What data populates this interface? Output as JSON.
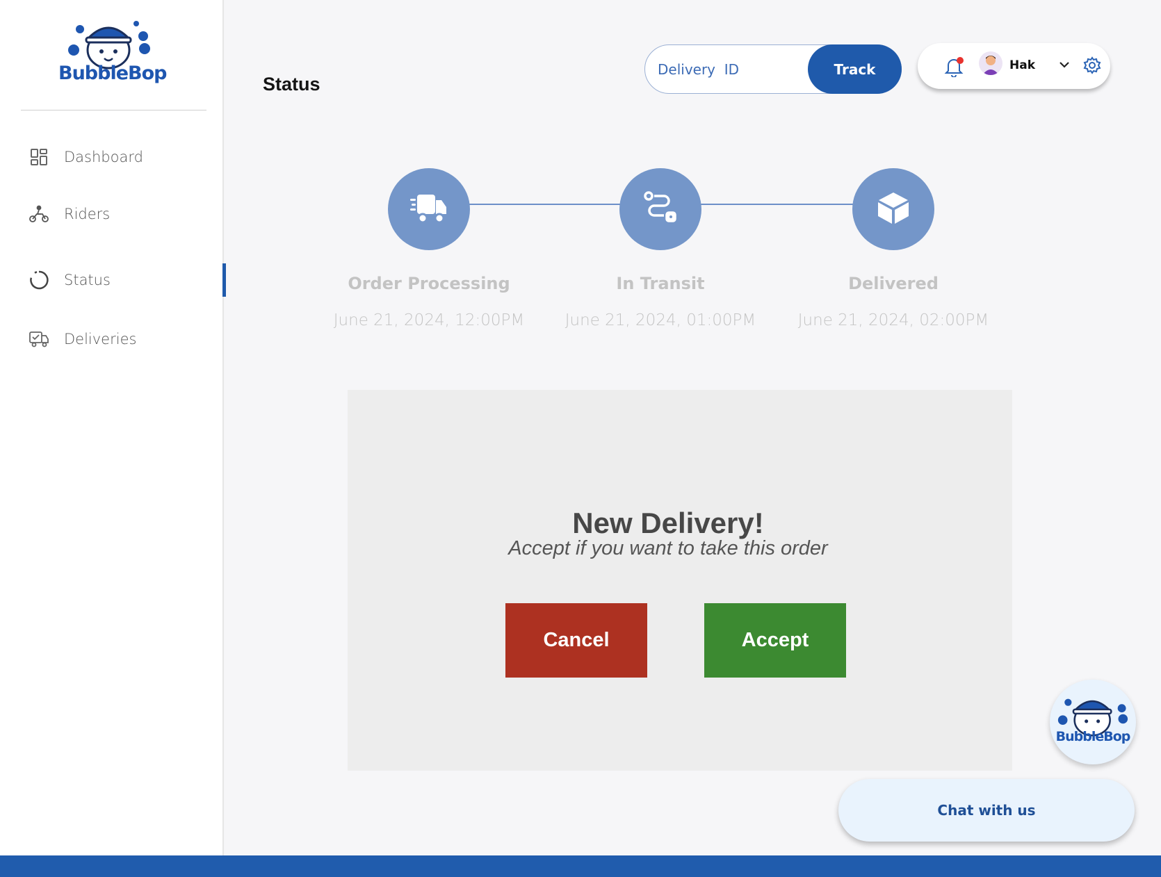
{
  "brand": {
    "name": "BubbleBop",
    "primary_color": "#1f5aab"
  },
  "sidebar": {
    "items": [
      {
        "label": "Dashboard",
        "icon": "grid-icon"
      },
      {
        "label": "Riders",
        "icon": "motorbike-icon"
      },
      {
        "label": "Status",
        "icon": "circle-progress-icon",
        "active": true
      },
      {
        "label": "Deliveries",
        "icon": "truck-check-icon"
      }
    ]
  },
  "header": {
    "title": "Status",
    "track": {
      "placeholder": "Delivery  ID",
      "button_label": "Track"
    },
    "user": {
      "name": "Hak",
      "has_notification": true
    }
  },
  "timeline": {
    "steps": [
      {
        "title": "Order Processing",
        "date": "June 21, 2024, 12:00PM",
        "icon": "fast-truck-icon"
      },
      {
        "title": "In Transit",
        "date": "June 21, 2024, 01:00PM",
        "icon": "route-icon"
      },
      {
        "title": "Delivered",
        "date": "June 21, 2024, 02:00PM",
        "icon": "box-icon"
      }
    ]
  },
  "dialog": {
    "title": "New Delivery!",
    "subtitle": "Accept if you want to take this order",
    "cancel_label": "Cancel",
    "accept_label": "Accept",
    "cancel_color": "#ad3121",
    "accept_color": "#3c8a31"
  },
  "chat": {
    "button_label": "Chat with us"
  }
}
